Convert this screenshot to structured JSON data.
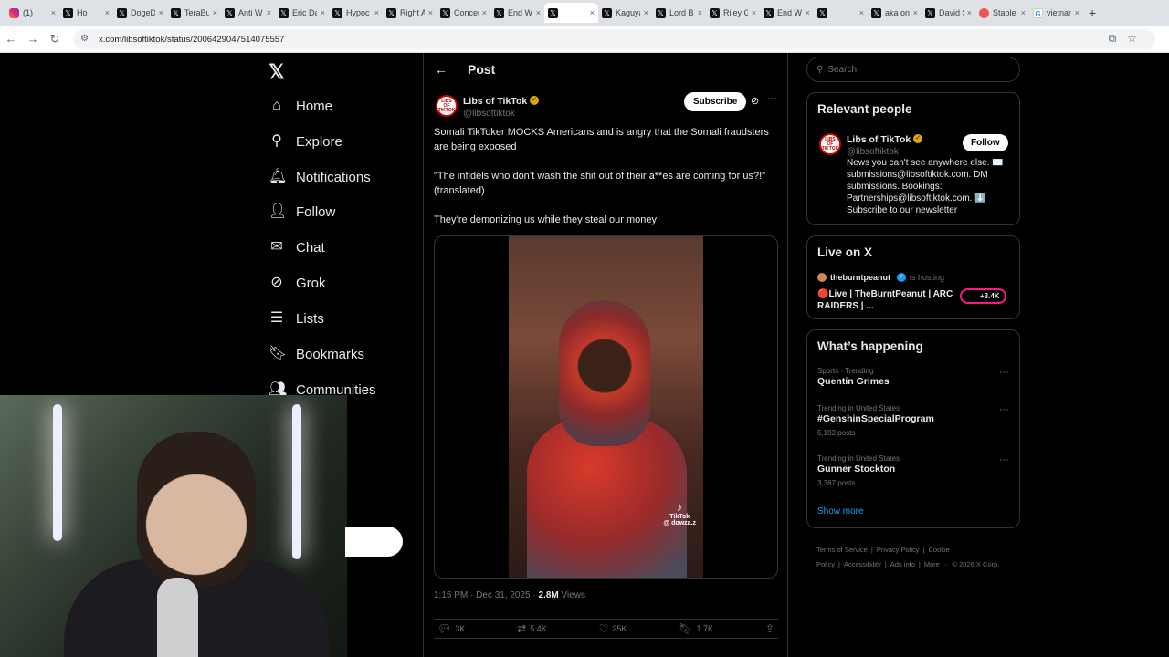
{
  "browser": {
    "tabs": [
      {
        "label": "(1)",
        "favicon": "instagram-icon",
        "glyph": ""
      },
      {
        "label": "Ho",
        "favicon": "x-icon",
        "glyph": "𝕏"
      },
      {
        "label": "DogeD",
        "favicon": "x-icon",
        "glyph": "𝕏"
      },
      {
        "label": "TeraBu",
        "favicon": "x-icon",
        "glyph": "𝕏"
      },
      {
        "label": "Anti W",
        "favicon": "x-icon",
        "glyph": "𝕏"
      },
      {
        "label": "Eric Da",
        "favicon": "x-icon",
        "glyph": "𝕏"
      },
      {
        "label": "Hypoc",
        "favicon": "x-icon",
        "glyph": "𝕏"
      },
      {
        "label": "Right A",
        "favicon": "x-icon",
        "glyph": "𝕏"
      },
      {
        "label": "Concer",
        "favicon": "x-icon",
        "glyph": "𝕏"
      },
      {
        "label": "End W",
        "favicon": "x-icon",
        "glyph": "𝕏"
      },
      {
        "label": "",
        "favicon": "x-icon",
        "glyph": "𝕏"
      },
      {
        "label": "Kaguya",
        "favicon": "x-icon",
        "glyph": "𝕏"
      },
      {
        "label": "Lord Be",
        "favicon": "x-icon",
        "glyph": "𝕏"
      },
      {
        "label": "Riley G",
        "favicon": "x-icon",
        "glyph": "𝕏"
      },
      {
        "label": "End W",
        "favicon": "x-icon",
        "glyph": "𝕏"
      },
      {
        "label": "",
        "favicon": "x-icon",
        "glyph": "𝕏"
      },
      {
        "label": "aka on",
        "favicon": "x-icon",
        "glyph": "𝕏"
      },
      {
        "label": "David S",
        "favicon": "x-icon",
        "glyph": "𝕏"
      },
      {
        "label": "Stable",
        "favicon": "stable-icon",
        "glyph": ""
      },
      {
        "label": "vietnam",
        "favicon": "google-icon",
        "glyph": "G"
      }
    ],
    "url": "x.com/libsoftiktok/status/2006429047514075557"
  },
  "nav": {
    "logo": "𝕏",
    "items": [
      {
        "label": "Home",
        "icon": "home-icon",
        "glyph": "⌂"
      },
      {
        "label": "Explore",
        "icon": "search-icon",
        "glyph": "⚲"
      },
      {
        "label": "Notifications",
        "icon": "bell-icon",
        "glyph": "🔔︎"
      },
      {
        "label": "Follow",
        "icon": "add-person-icon",
        "glyph": "👤︎"
      },
      {
        "label": "Chat",
        "icon": "mail-icon",
        "glyph": "✉"
      },
      {
        "label": "Grok",
        "icon": "grok-icon",
        "glyph": "⊘"
      },
      {
        "label": "Lists",
        "icon": "list-icon",
        "glyph": "☰"
      },
      {
        "label": "Bookmarks",
        "icon": "bookmark-icon",
        "glyph": "🔖︎"
      },
      {
        "label": "Communities",
        "icon": "communities-icon",
        "glyph": "👥︎"
      }
    ]
  },
  "post": {
    "header_title": "Post",
    "author_name": "Libs of TikTok",
    "author_handle": "@libsoftiktok",
    "subscribe_label": "Subscribe",
    "text_1": "Somali TikToker MOCKS Americans and is angry that the Somali fraudsters are being exposed",
    "text_2": "\"The infidels who don’t wash the shit out of their a**es are coming for us?!\" (translated)",
    "text_3": "They’re demonizing us while they steal our money",
    "video_watermark": "TikTok",
    "video_handle": "@ dowza.z",
    "time": "1:15 PM · Dec 31, 2025 · ",
    "views_count": "2.8M",
    "views_label": " Views",
    "replies": "3K",
    "reposts": "5.4K",
    "likes": "25K",
    "bookmarks": "1.7K"
  },
  "sidebar": {
    "search_placeholder": "Search",
    "relevant_title": "Relevant people",
    "rp_name": "Libs of TikTok",
    "rp_handle": "@libsoftiktok",
    "rp_follow": "Follow",
    "rp_bio": "News you can't see anywhere else. ✉️ submissions@libsoftiktok.com. DM submissions. Bookings: Partnerships@libsoftiktok.com. ⬇️ Subscribe to our newsletter",
    "live_title": "Live on X",
    "live_host": "theburntpeanut",
    "live_hosting": "is hosting",
    "live_stream_title": "🔴Live | TheBurntPeanut | ARC RAIDERS | ...",
    "live_count": "+3.4K",
    "happening_title": "What’s happening",
    "trends": [
      {
        "category": "Sports · Trending",
        "name": "Quentin Grimes",
        "posts": ""
      },
      {
        "category": "Trending in United States",
        "name": "#GenshinSpecialProgram",
        "posts": "5,192 posts"
      },
      {
        "category": "Trending in United States",
        "name": "Gunner Stockton",
        "posts": "3,387 posts"
      }
    ],
    "show_more": "Show more",
    "footer": [
      "Terms of Service",
      "|",
      "Privacy Policy",
      "|",
      "Cookie Policy",
      "|",
      "Accessibility",
      "|",
      "Ads info",
      "|",
      "More ···",
      "© 2026 X Corp."
    ]
  }
}
